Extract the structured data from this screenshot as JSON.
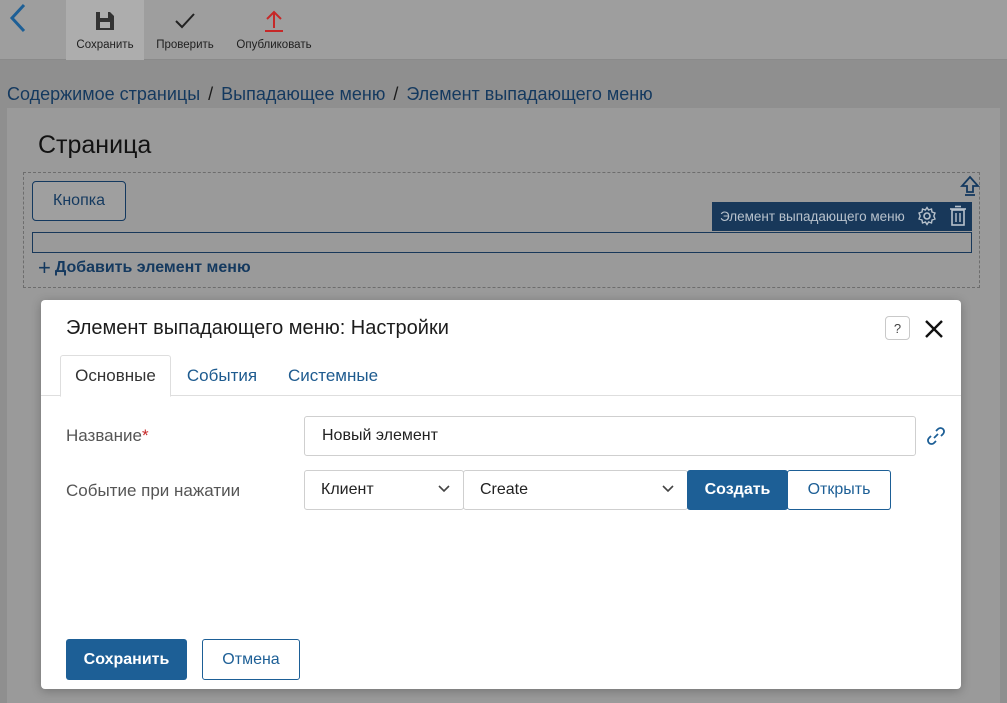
{
  "toolbar": {
    "save_label": "Сохранить",
    "check_label": "Проверить",
    "publish_label": "Опубликовать"
  },
  "breadcrumb": {
    "items": [
      "Содержимое страницы",
      "Выпадающее меню",
      "Элемент выпадающего меню"
    ],
    "separator": "/"
  },
  "page": {
    "title": "Страница",
    "button_label": "Кнопка",
    "selected_element_label": "Элемент выпадающего меню",
    "add_item_label": "Добавить элемент меню"
  },
  "modal": {
    "title": "Элемент выпадающего меню: Настройки",
    "help_glyph": "?",
    "tabs": [
      {
        "label": "Основные",
        "active": true
      },
      {
        "label": "События",
        "active": false
      },
      {
        "label": "Системные",
        "active": false
      }
    ],
    "fields": {
      "name_label": "Название",
      "name_required_mark": "*",
      "name_value": "Новый элемент",
      "click_event_label": "Событие при нажатии",
      "event_type_value": "Клиент",
      "event_action_value": "Create",
      "create_label": "Создать",
      "open_label": "Открыть"
    },
    "footer": {
      "save_label": "Сохранить",
      "cancel_label": "Отмена"
    }
  },
  "colors": {
    "primary": "#1d5f96",
    "dark_navy": "#18385a",
    "required": "#c62828",
    "publish_icon": "#c62828"
  },
  "icons": [
    "back-arrow-icon",
    "floppy-disk-icon",
    "checkmark-icon",
    "upload-arrow-icon",
    "move-up-icon",
    "gear-icon",
    "trash-icon",
    "help-icon",
    "close-icon",
    "link-icon",
    "chevron-down-icon"
  ]
}
